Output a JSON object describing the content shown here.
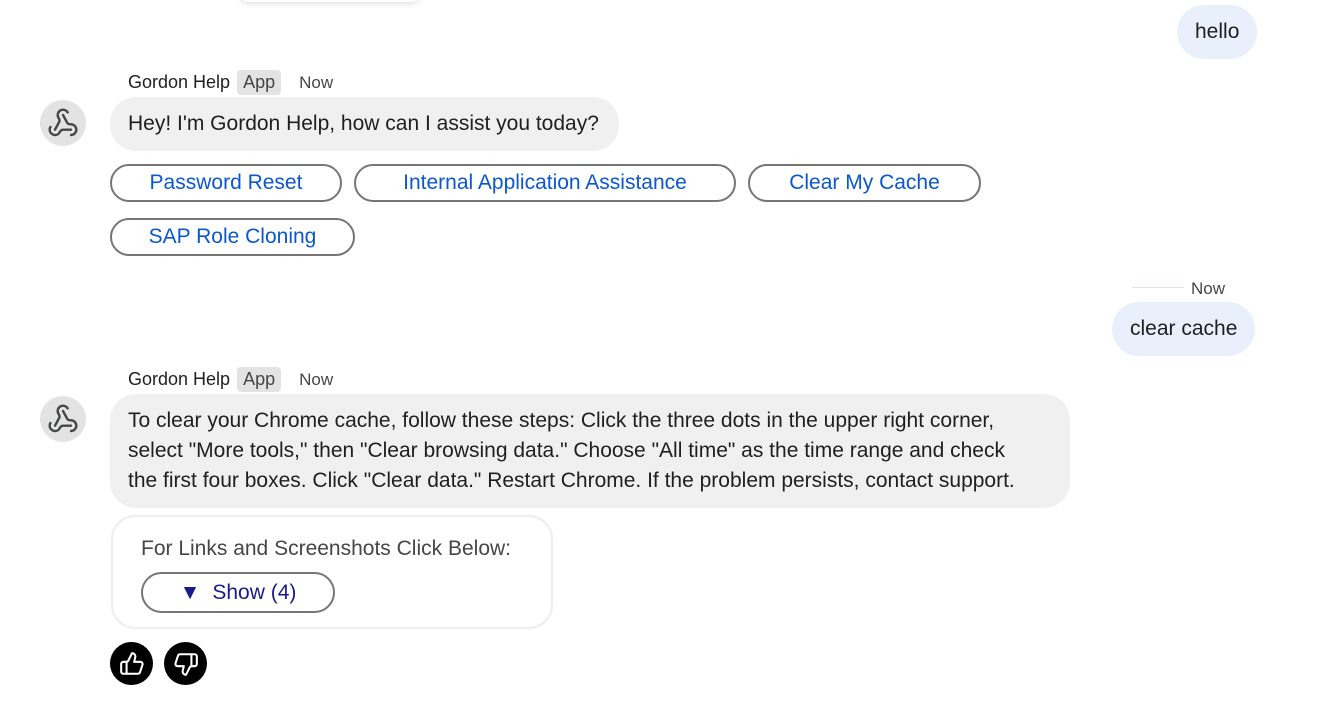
{
  "messages": {
    "user1": {
      "text": "hello"
    },
    "bot1": {
      "name": "Gordon Help",
      "badge": "App",
      "time": "Now",
      "text": "Hey! I'm Gordon Help, how can I assist you today?",
      "chips": [
        "Password Reset",
        "Internal Application Assistance",
        "Clear My Cache",
        "SAP Role Cloning"
      ]
    },
    "user2": {
      "time": "Now",
      "text": "clear cache"
    },
    "bot2": {
      "name": "Gordon Help",
      "badge": "App",
      "time": "Now",
      "lines": [
        "To clear your Chrome cache, follow these steps: Click the three dots in the upper right corner,",
        "select \"More tools,\" then \"Clear browsing data.\" Choose \"All time\" as the time range and check",
        "the first four boxes. Click \"Clear data.\" Restart Chrome. If the problem persists, contact support."
      ],
      "card_label": "For Links and Screenshots Click Below:",
      "show_arrow": "▼",
      "show_label": "Show (4)"
    }
  },
  "icons": {
    "avatar": "webhook-icon",
    "thumbs_up": "thumbs-up-icon",
    "thumbs_down": "thumbs-down-icon"
  },
  "colors": {
    "user_bubble": "#eaf0fb",
    "bot_bubble": "#f0f0f0",
    "chip_text": "#0b57d0",
    "show_text": "#1a1a8c"
  }
}
